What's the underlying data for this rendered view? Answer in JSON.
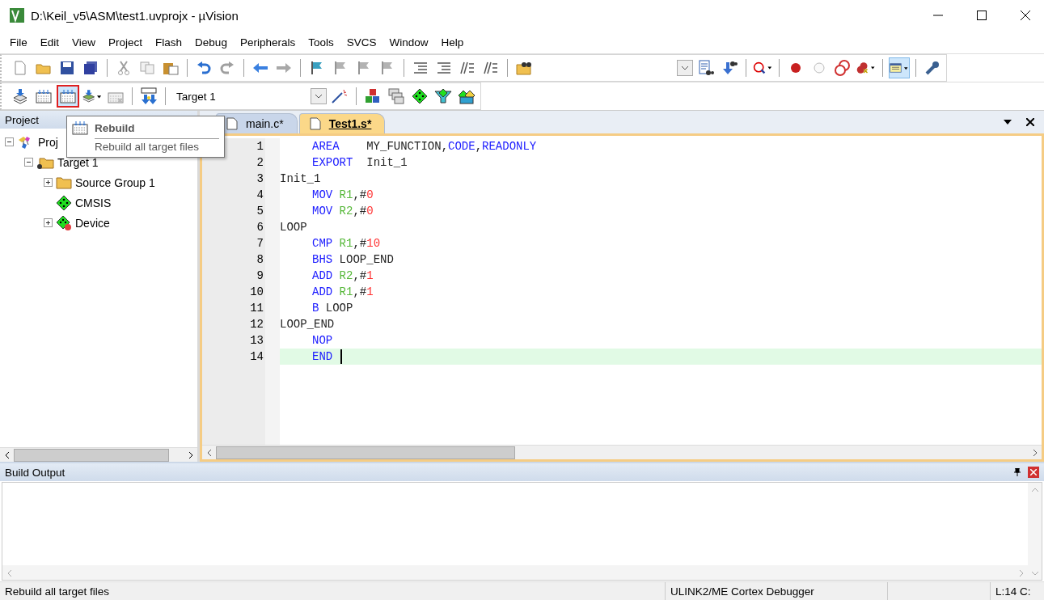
{
  "window": {
    "title": "D:\\Keil_v5\\ASM\\test1.uvprojx - µVision"
  },
  "menu": [
    "File",
    "Edit",
    "View",
    "Project",
    "Flash",
    "Debug",
    "Peripherals",
    "Tools",
    "SVCS",
    "Window",
    "Help"
  ],
  "toolbar_1": [
    {
      "kind": "new",
      "disabled": false
    },
    {
      "kind": "open",
      "disabled": false
    },
    {
      "kind": "save",
      "disabled": false
    },
    {
      "kind": "save-all",
      "disabled": false
    },
    {
      "kind": "sep"
    },
    {
      "kind": "cut",
      "disabled": true
    },
    {
      "kind": "copy",
      "disabled": true
    },
    {
      "kind": "paste",
      "disabled": false
    },
    {
      "kind": "sep"
    },
    {
      "kind": "undo",
      "disabled": false
    },
    {
      "kind": "redo",
      "disabled": true
    },
    {
      "kind": "sep"
    },
    {
      "kind": "back",
      "disabled": false
    },
    {
      "kind": "forward",
      "disabled": true
    },
    {
      "kind": "sep"
    },
    {
      "kind": "bookmark",
      "disabled": false
    },
    {
      "kind": "bookmark",
      "disabled": true
    },
    {
      "kind": "bookmark",
      "disabled": true
    },
    {
      "kind": "bookmark",
      "disabled": true
    },
    {
      "kind": "sep"
    },
    {
      "kind": "indent",
      "disabled": false
    },
    {
      "kind": "indent",
      "disabled": false
    },
    {
      "kind": "comment",
      "disabled": false
    },
    {
      "kind": "comment",
      "disabled": false
    },
    {
      "kind": "sep"
    },
    {
      "kind": "find-files",
      "disabled": false
    },
    {
      "kind": "gap"
    },
    {
      "kind": "combo"
    },
    {
      "kind": "find-doc",
      "disabled": false
    },
    {
      "kind": "incremental",
      "disabled": false
    },
    {
      "kind": "sep"
    },
    {
      "kind": "debug",
      "disabled": false
    },
    {
      "kind": "sep"
    },
    {
      "kind": "breakpoint",
      "disabled": false
    },
    {
      "kind": "breakpoint-off",
      "disabled": false
    },
    {
      "kind": "breakpoint-disable",
      "disabled": false
    },
    {
      "kind": "breakpoint-kill",
      "disabled": false
    },
    {
      "kind": "sep"
    },
    {
      "kind": "window",
      "disabled": false,
      "pressed": true
    },
    {
      "kind": "sep"
    },
    {
      "kind": "wrench",
      "disabled": false
    }
  ],
  "toolbar_2": {
    "buttons_left": [
      {
        "kind": "translate",
        "disabled": false,
        "pressed": false
      },
      {
        "kind": "build",
        "disabled": false,
        "pressed": false
      },
      {
        "kind": "rebuild",
        "disabled": false,
        "pressed": true
      },
      {
        "kind": "batch",
        "disabled": false,
        "pressed": false
      },
      {
        "kind": "stop",
        "disabled": true,
        "pressed": false
      },
      {
        "kind": "sep"
      },
      {
        "kind": "load",
        "disabled": false,
        "pressed": false
      },
      {
        "kind": "sep"
      }
    ],
    "target": "Target 1",
    "buttons_right": [
      {
        "kind": "magic",
        "disabled": false,
        "pressed": false
      },
      {
        "kind": "sep"
      },
      {
        "kind": "manage",
        "disabled": false,
        "pressed": false
      },
      {
        "kind": "layers",
        "disabled": false,
        "pressed": false
      },
      {
        "kind": "diamond",
        "disabled": false,
        "pressed": false
      },
      {
        "kind": "funnel",
        "disabled": false,
        "pressed": false
      },
      {
        "kind": "packs",
        "disabled": false,
        "pressed": false
      }
    ]
  },
  "project_panel": {
    "title": "Project",
    "tree": [
      {
        "label": "Proj",
        "kind": "project",
        "expanded": true,
        "children": [
          {
            "label": "Target 1",
            "kind": "target",
            "expanded": true,
            "children": [
              {
                "label": "Source Group 1",
                "kind": "folder",
                "expanded": false
              },
              {
                "label": "CMSIS",
                "kind": "component"
              },
              {
                "label": "Device",
                "kind": "device",
                "expanded": false
              }
            ]
          }
        ]
      }
    ]
  },
  "tooltip": {
    "title": "Rebuild",
    "description": "Rebuild all target files"
  },
  "editor": {
    "tabs": [
      {
        "label": "main.c*",
        "selected": false
      },
      {
        "label": "Test1.s*",
        "selected": true
      }
    ],
    "lines": [
      {
        "number": "1",
        "indented": true,
        "current": false,
        "tokens": [
          {
            "kind": "keyword",
            "text": "AREA"
          },
          {
            "kind": "plain",
            "text": "    MY_FUNCTION,"
          },
          {
            "kind": "keyword",
            "text": "CODE"
          },
          {
            "kind": "plain",
            "text": ","
          },
          {
            "kind": "keyword",
            "text": "READONLY"
          }
        ]
      },
      {
        "number": "2",
        "indented": true,
        "current": false,
        "tokens": [
          {
            "kind": "keyword",
            "text": "EXPORT"
          },
          {
            "kind": "plain",
            "text": "  Init_1"
          }
        ]
      },
      {
        "number": "3",
        "indented": false,
        "current": false,
        "tokens": [
          {
            "kind": "plain",
            "text": "Init_1"
          }
        ]
      },
      {
        "number": "4",
        "indented": true,
        "current": false,
        "tokens": [
          {
            "kind": "keyword",
            "text": "MOV"
          },
          {
            "kind": "register",
            "text": " R1"
          },
          {
            "kind": "plain",
            "text": ",#"
          },
          {
            "kind": "number",
            "text": "0"
          }
        ]
      },
      {
        "number": "5",
        "indented": true,
        "current": false,
        "tokens": [
          {
            "kind": "keyword",
            "text": "MOV"
          },
          {
            "kind": "register",
            "text": " R2"
          },
          {
            "kind": "plain",
            "text": ",#"
          },
          {
            "kind": "number",
            "text": "0"
          }
        ]
      },
      {
        "number": "6",
        "indented": false,
        "current": false,
        "tokens": [
          {
            "kind": "plain",
            "text": "LOOP"
          }
        ]
      },
      {
        "number": "7",
        "indented": true,
        "current": false,
        "tokens": [
          {
            "kind": "keyword",
            "text": "CMP"
          },
          {
            "kind": "register",
            "text": " R1"
          },
          {
            "kind": "plain",
            "text": ",#"
          },
          {
            "kind": "number",
            "text": "10"
          }
        ]
      },
      {
        "number": "8",
        "indented": true,
        "current": false,
        "tokens": [
          {
            "kind": "keyword",
            "text": "BHS"
          },
          {
            "kind": "plain",
            "text": " LOOP_END"
          }
        ]
      },
      {
        "number": "9",
        "indented": true,
        "current": false,
        "tokens": [
          {
            "kind": "keyword",
            "text": "ADD"
          },
          {
            "kind": "register",
            "text": " R2"
          },
          {
            "kind": "plain",
            "text": ",#"
          },
          {
            "kind": "number",
            "text": "1"
          }
        ]
      },
      {
        "number": "10",
        "indented": true,
        "current": false,
        "tokens": [
          {
            "kind": "keyword",
            "text": "ADD"
          },
          {
            "kind": "register",
            "text": " R1"
          },
          {
            "kind": "plain",
            "text": ",#"
          },
          {
            "kind": "number",
            "text": "1"
          }
        ]
      },
      {
        "number": "11",
        "indented": true,
        "current": false,
        "tokens": [
          {
            "kind": "keyword",
            "text": "B"
          },
          {
            "kind": "plain",
            "text": " LOOP"
          }
        ]
      },
      {
        "number": "12",
        "indented": false,
        "current": false,
        "tokens": [
          {
            "kind": "plain",
            "text": "LOOP_END"
          }
        ]
      },
      {
        "number": "13",
        "indented": true,
        "current": false,
        "tokens": [
          {
            "kind": "keyword",
            "text": "NOP"
          }
        ]
      },
      {
        "number": "14",
        "indented": true,
        "current": true,
        "tokens": [
          {
            "kind": "keyword",
            "text": "END"
          }
        ]
      }
    ]
  },
  "build_output": {
    "title": "Build Output"
  },
  "status_bar": {
    "message": "Rebuild all target files",
    "debugger": "ULINK2/ME Cortex Debugger",
    "position": "L:14 C:"
  }
}
